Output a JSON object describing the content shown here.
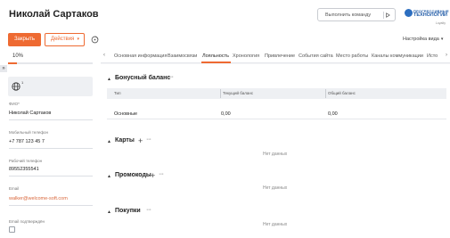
{
  "header": {
    "title": "Николай Сартаков",
    "command_placeholder": "Выполнить команду",
    "logo_line1": "ПРОГРЕССИВНЫЕ",
    "logo_line2": "ТЕХНОЛОГИИ",
    "logo_sub": "Loyalty"
  },
  "toolbar": {
    "close_label": "Закрыть",
    "actions_label": "Действия",
    "view_settings_label": "Настройка вида"
  },
  "profile": {
    "progress_text": "10%",
    "progress_fraction": 0.1,
    "avatar_badge": "1",
    "fields": [
      {
        "label": "ФИО*",
        "value": "Николай Сартаков"
      },
      {
        "label": "Мобильный телефон",
        "value": "+7 787 123 45 7"
      },
      {
        "label": "Рабочий телефон",
        "value": "89552355541"
      },
      {
        "label": "Email",
        "value": "walker@welcome-soft.com"
      },
      {
        "label": "Email подтверждён",
        "value": ""
      }
    ]
  },
  "tabs": [
    {
      "label": "Основная информация"
    },
    {
      "label": "Взаимосвязи"
    },
    {
      "label": "Лояльность"
    },
    {
      "label": "Хронология"
    },
    {
      "label": "Привлечение"
    },
    {
      "label": "События сайта"
    },
    {
      "label": "Место работы"
    },
    {
      "label": "Каналы коммуникации"
    },
    {
      "label": "Исто"
    }
  ],
  "active_tab": "Лояльность",
  "bonus": {
    "title": "Бонусный баланс",
    "columns": [
      "Тип",
      "Текущий баланс",
      "Общий баланс"
    ],
    "rows": [
      [
        "Основные",
        "0,00",
        "0,00"
      ]
    ]
  },
  "cards": {
    "title": "Карты",
    "empty": "Нет данных"
  },
  "promo": {
    "title": "Промокоды",
    "empty": "Нет данных"
  },
  "purchases": {
    "title": "Покупки",
    "empty": "Нет данных"
  },
  "colors": {
    "accent": "#ee6a32",
    "brand": "#1f5aa6"
  }
}
